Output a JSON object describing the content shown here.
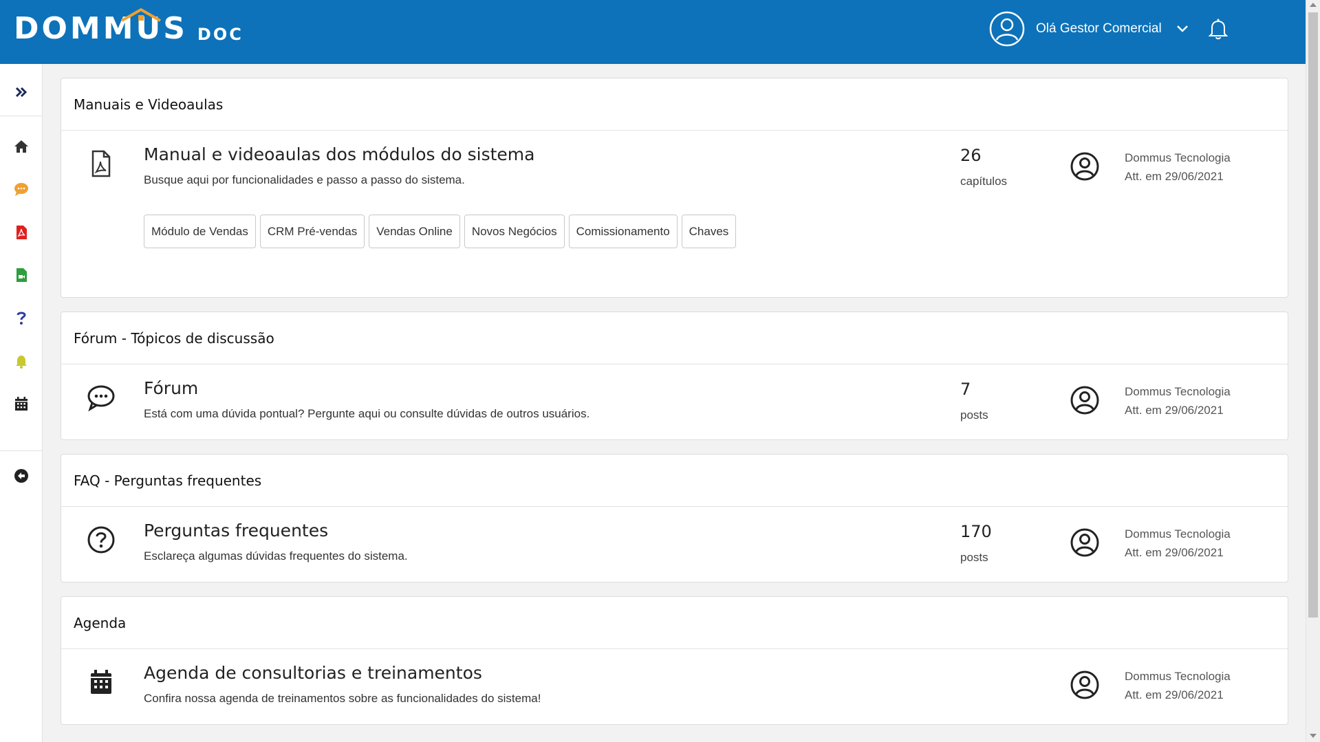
{
  "header": {
    "logo_main": "DOMMUS",
    "logo_sub": "DOC",
    "greeting": "Olá Gestor Comercial",
    "brand_color": "#0d72b9",
    "accent_color": "#f0a030"
  },
  "sidebar": {
    "items": [
      {
        "icon": "expand-icon",
        "color": "#1a2b5e"
      },
      {
        "icon": "home-icon",
        "color": "#333333"
      },
      {
        "icon": "chat-icon",
        "color": "#f0a030"
      },
      {
        "icon": "pdf-icon",
        "color": "#e02020"
      },
      {
        "icon": "video-file-icon",
        "color": "#2e9e3e"
      },
      {
        "icon": "question-icon",
        "color": "#2d3e9e"
      },
      {
        "icon": "bell-icon",
        "color": "#c8c830"
      },
      {
        "icon": "calendar-icon",
        "color": "#222222"
      },
      {
        "icon": "back-arrow-icon",
        "color": "#222222"
      }
    ]
  },
  "sections": {
    "manuais": {
      "header": "Manuais e Videoaulas",
      "title": "Manual e videoaulas dos módulos do sistema",
      "description": "Busque aqui por funcionalidades e passo a passo do sistema.",
      "count": "26",
      "count_label": "capítulos",
      "author": "Dommus Tecnologia",
      "updated": "Att. em 29/06/2021",
      "tags": [
        "Módulo de Vendas",
        "CRM Pré-vendas",
        "Vendas Online",
        "Novos Negócios",
        "Comissionamento",
        "Chaves"
      ]
    },
    "forum": {
      "header": "Fórum - Tópicos de discussão",
      "title": "Fórum",
      "description": "Está com uma dúvida pontual? Pergunte aqui ou consulte dúvidas de outros usuários.",
      "count": "7",
      "count_label": "posts",
      "author": "Dommus Tecnologia",
      "updated": "Att. em 29/06/2021"
    },
    "faq": {
      "header": "FAQ - Perguntas frequentes",
      "title": "Perguntas frequentes",
      "description": "Esclareça algumas dúvidas frequentes do sistema.",
      "count": "170",
      "count_label": "posts",
      "author": "Dommus Tecnologia",
      "updated": "Att. em 29/06/2021"
    },
    "agenda": {
      "header": "Agenda",
      "title": "Agenda de consultorias e treinamentos",
      "description": "Confira nossa agenda de treinamentos sobre as funcionalidades do sistema!",
      "author": "Dommus Tecnologia",
      "updated": "Att. em 29/06/2021"
    }
  }
}
